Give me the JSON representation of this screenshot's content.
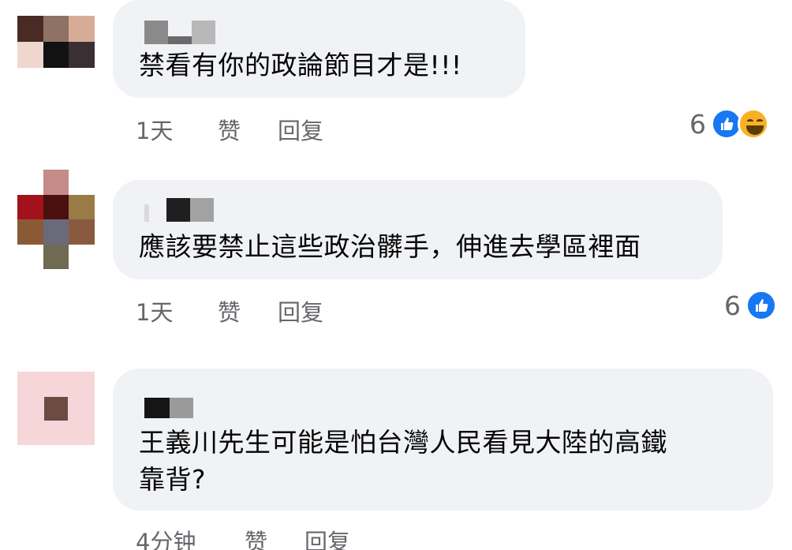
{
  "comments": [
    {
      "text": "禁看有你的政論節目才是!!!",
      "time": "1天",
      "like_label": "赞",
      "reply_label": "回复",
      "reaction_count": "6",
      "reactions": [
        "like-icon",
        "haha-icon"
      ]
    },
    {
      "text": "應該要禁止這些政治髒手，伸進去學區裡面",
      "time": "1天",
      "like_label": "赞",
      "reply_label": "回复",
      "reaction_count": "6",
      "reactions": [
        "like-icon"
      ]
    },
    {
      "text_line1": "王義川先生可能是怕台灣人民看見大陸的高鐵",
      "text_line2": "靠背?",
      "time": "4分钟",
      "like_label": "赞",
      "reply_label": "回复"
    }
  ],
  "colors": {
    "bubble": "#f0f2f5",
    "meta_text": "#65676b",
    "like_blue": "#1877f2",
    "haha_yellow": "#f7b125"
  }
}
